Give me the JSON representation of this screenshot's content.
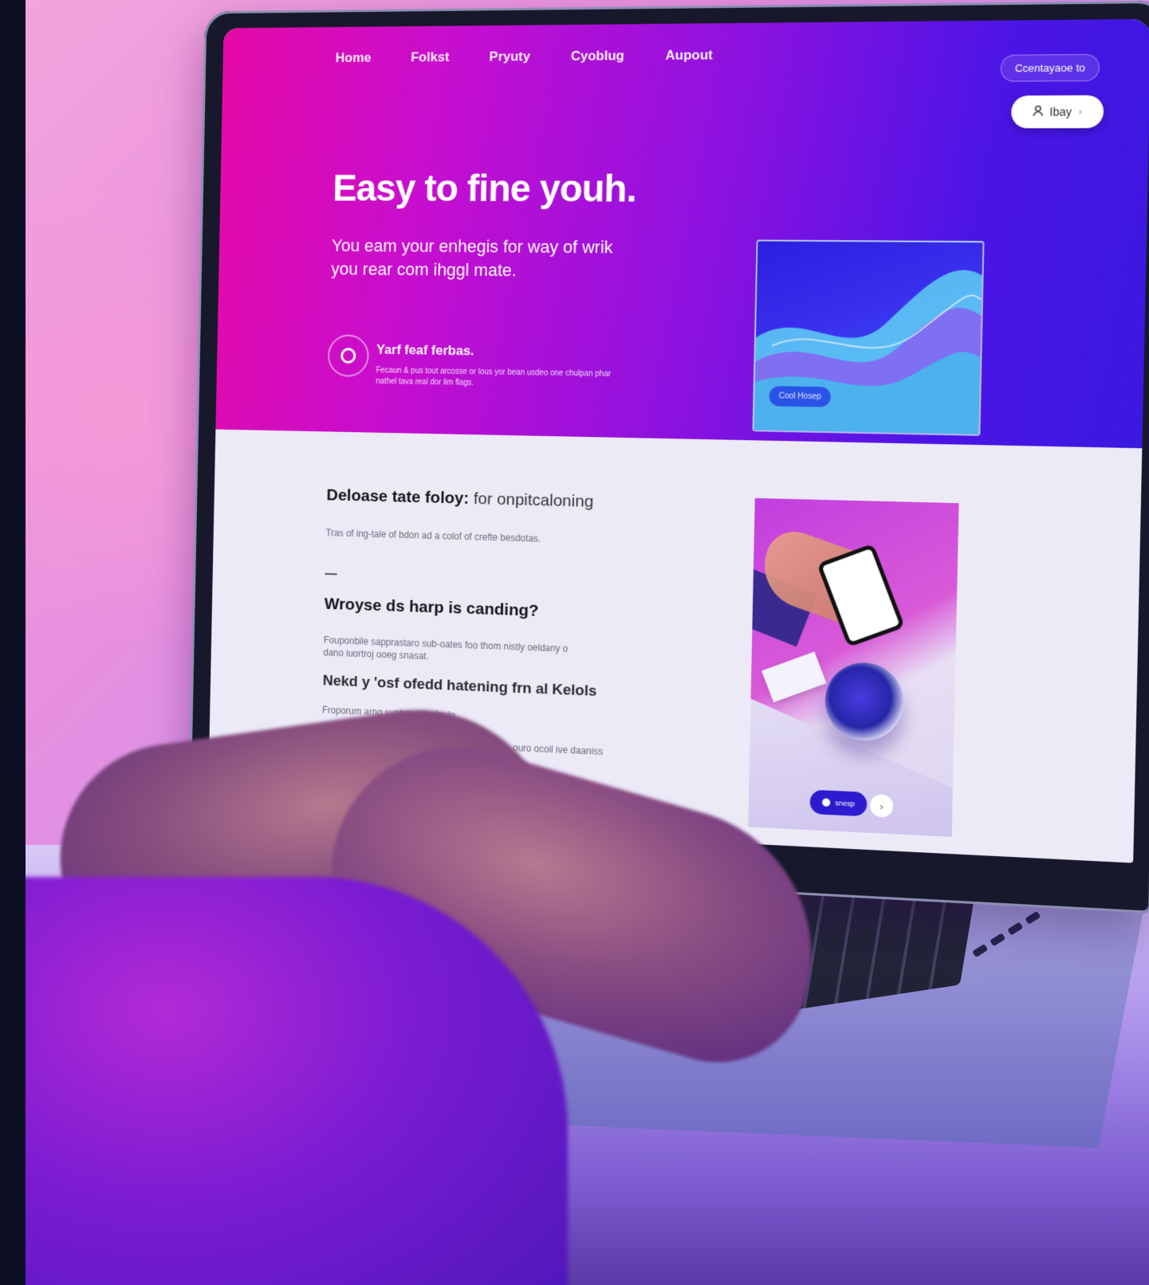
{
  "nav": {
    "items": [
      "Home",
      "Folkst",
      "Pryuty",
      "Cyoblug",
      "Aupout"
    ],
    "contact": "Ccentayaoe to",
    "login": "Ibay"
  },
  "hero": {
    "title": "Easy to fine youh.",
    "subtitle": "You eam your enhegis for way of wrik you rear com ihggl mate.",
    "feature_title": "Yarf feaf ferbas.",
    "feature_desc": "Fecaun & pus tout arcosse or lous yor bean usdeo one chulpan phar nathel tava real dor lim flags.",
    "wave_button": "Cool Hosep"
  },
  "content": {
    "title1": "Deloase tate foloy:",
    "title1_light": "for onpitcaloning",
    "para1": "Tras of ing-tale of bdon ad a colof of crefte besdotas.",
    "title2": "Wroyse ds harp is canding?",
    "para2": "Fouponbile sapprastaro sub-oates foo thom nistly oeldany o dano iuortroj ooeg snasat.",
    "title3": "Nekd y 'osf ofedd hatening frn al Kelols",
    "para3": "Froporum arng sunbre a la dnulo",
    "para4": "ouro ocoil ive daaniss",
    "photo_button": "snesp",
    "photo_next": "›"
  },
  "colors": {
    "hero_start": "#e60aa6",
    "hero_end": "#3a19e0",
    "content_bg": "#eceaf7",
    "accent": "#2d1bd0"
  },
  "icons": {
    "login": "user-icon",
    "feature": "circle-icon",
    "next": "chevron-right-icon"
  }
}
